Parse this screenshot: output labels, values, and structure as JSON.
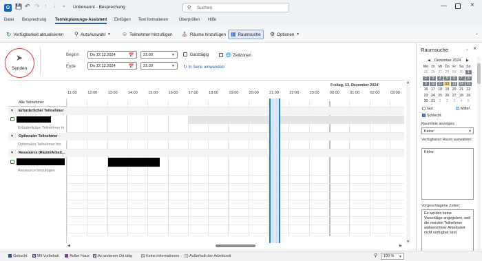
{
  "titlebar": {
    "doc_title": "Unbenannt - Besprechung",
    "search_placeholder": "Suchen"
  },
  "ribbon_tabs": [
    "Datei",
    "Besprechung",
    "Terminplanungs-Assistent",
    "Einfügen",
    "Text formatieren",
    "Überprüfen",
    "Hilfe"
  ],
  "ribbon": {
    "refresh": "Verfügbarkeit aktualisieren",
    "autoselect": "AutoAuswahl",
    "add_attendees": "Teilnehmer hinzufügen",
    "add_rooms": "Räume hinzufügen",
    "room_finder": "Raumsuche",
    "options": "Optionen"
  },
  "send": {
    "label": "Senden"
  },
  "form": {
    "start_label": "Beginn",
    "end_label": "Ende",
    "start_date": "Do 12.12.2024",
    "start_time": "21:00",
    "end_date": "Do 12.12.2024",
    "end_time": "21:30",
    "allday": "Ganztägig",
    "timezones": "Zeitzonen",
    "recurring": "In Serie umwandeln"
  },
  "schedule": {
    "date_header": "Freitag, 13. Dezember 2024",
    "hours": [
      "11:00",
      "12:00",
      "13:00",
      "14:00",
      "15:00",
      "16:00",
      "17:00",
      "18:00",
      "19:00",
      "20:00",
      "21:00",
      "22:00",
      "23:00",
      "00:00",
      "01:00",
      "02:00",
      "03:00"
    ],
    "all_attendees": "Alle Teilnehmer",
    "required_header": "Erforderlicher Teilnehmer",
    "required_add": "Erforderlichen Teilnehmer hi",
    "optional_header": "Optionaler Teilnehmer",
    "optional_add": "Optionalen Teilnehmer hin",
    "resource_header": "Ressource (Raum/Arbeit...",
    "resource_add": "Ressource hinzufügen"
  },
  "room_pane": {
    "title": "Raumsuche",
    "month": "Dezember 2024",
    "weekdays": [
      "Mo",
      "Di",
      "Mi",
      "Do",
      "Fr",
      "Sa",
      "So"
    ],
    "weeks": [
      [
        "25",
        "26",
        "27",
        "28",
        "29",
        "30",
        "1"
      ],
      [
        "2",
        "3",
        "4",
        "5",
        "6",
        "7",
        "8"
      ],
      [
        "9",
        "10",
        "11",
        "12",
        "13",
        "14",
        "15"
      ],
      [
        "16",
        "17",
        "18",
        "19",
        "20",
        "21",
        "22"
      ],
      [
        "23",
        "24",
        "25",
        "26",
        "27",
        "28",
        "29"
      ],
      [
        "30",
        "31",
        "1",
        "2",
        "3",
        "4",
        "5"
      ]
    ],
    "legend_good": "Gut",
    "legend_medium": "Mittel",
    "legend_bad": "Schlecht",
    "roomlist_label": "Raumliste anzeigen:",
    "roomlist_value": "Keine",
    "available_label": "Verfügbaren Raum auswählen:",
    "available_value": "Keine",
    "suggested_label": "Vorgeschlagene Zeiten:",
    "suggested_text": "Es werden keine Vorschläge angegeben, weil die meisten Teilnehmer während ihrer Arbeitszeit nicht verfügbar sind."
  },
  "status": {
    "busy": "Gebucht",
    "tentative": "Mit Vorbehalt",
    "away": "Außer Haus",
    "elsewhere": "An anderem Ort tätig",
    "noinfo": "Keine Informationen",
    "outside": "Außerhalb der Arbeitszeit",
    "zoom": "100 %"
  },
  "colors": {
    "accent": "#1f5fae",
    "selection": "#2b7bd6",
    "busy": "#2b5797"
  }
}
